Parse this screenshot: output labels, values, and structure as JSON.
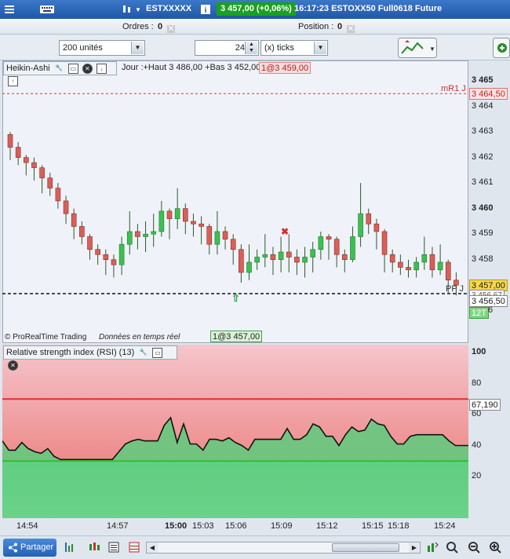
{
  "window": {
    "instrument": "ESTXXXXX",
    "price_change": "3 457,00 (+0,06%)",
    "time_name": "16:17:23 ESTOXX50 Full0618 Future",
    "icons": [
      "keyboard-icon",
      "chart-type-icon",
      "info-icon",
      "list-icon"
    ]
  },
  "order_bar": {
    "orders_label": "Ordres :",
    "orders_value": "0",
    "position_label": "Position :",
    "position_value": "0"
  },
  "toolbar": {
    "quantity": "200 unités",
    "ticks_value": "24",
    "ticks_unit": "(x) ticks"
  },
  "price_panel": {
    "indicator": "Heikin-Ashi",
    "info": "Jour :+Haut 3 486,00 +Bas 3 452,00",
    "order_tag": "1@3 459,00",
    "mr1_label": "mR1 J",
    "mr1_value": "3 464,50",
    "current_price": "3 457,00",
    "dashed_level": "3 456,67",
    "low_level": "3 456,50",
    "pp_label": "PP J",
    "tick_label": "12T",
    "tick_count": "6",
    "copyright": "© ProRealTime Trading",
    "realtime": "Données en temps réel",
    "fill_tag": "1@3 457,00",
    "y_labels": [
      {
        "v": 3465,
        "text": "3 465",
        "bold": true
      },
      {
        "v": 3464,
        "text": "3 464",
        "bold": false
      },
      {
        "v": 3463,
        "text": "3 463",
        "bold": false
      },
      {
        "v": 3462,
        "text": "3 462",
        "bold": false
      },
      {
        "v": 3461,
        "text": "3 461",
        "bold": false
      },
      {
        "v": 3460,
        "text": "3 460",
        "bold": true
      },
      {
        "v": 3459,
        "text": "3 459",
        "bold": false
      },
      {
        "v": 3458,
        "text": "3 458",
        "bold": false
      }
    ]
  },
  "rsi_panel": {
    "title": "Relative strength index (RSI) (13)",
    "value": "67,190",
    "y_labels": [
      "100",
      "80",
      "60",
      "40",
      "20"
    ],
    "upper": 70,
    "lower": 30
  },
  "x_axis": [
    {
      "text": "14:54",
      "bold": false
    },
    {
      "text": "14:57",
      "bold": false
    },
    {
      "text": "15:00",
      "bold": true
    },
    {
      "text": "15:03",
      "bold": false
    },
    {
      "text": "15:06",
      "bold": false
    },
    {
      "text": "15:09",
      "bold": false
    },
    {
      "text": "15:12",
      "bold": false
    },
    {
      "text": "15:15",
      "bold": false
    },
    {
      "text": "15:18",
      "bold": false
    },
    {
      "text": "15:24",
      "bold": false
    }
  ],
  "bottom_bar": {
    "share_label": "Partager"
  },
  "colors": {
    "bull": "#3cc050",
    "bear": "#d86058",
    "resistance": "#e03030",
    "support": "#30c030",
    "price_bg": "#f0f2fa"
  },
  "chart_data": {
    "type": "candlestick",
    "series": [
      {
        "name": "Heikin-Ashi",
        "ohlc": [
          [
            3462.9,
            3462.4,
            3463.0,
            3461.9
          ],
          [
            3462.4,
            3462.0,
            3462.6,
            3461.7
          ],
          [
            3462.0,
            3461.8,
            3462.1,
            3461.3
          ],
          [
            3461.8,
            3461.6,
            3462.0,
            3461.1
          ],
          [
            3461.6,
            3461.2,
            3461.7,
            3460.6
          ],
          [
            3461.2,
            3460.8,
            3461.4,
            3460.5
          ],
          [
            3460.8,
            3460.3,
            3461.0,
            3460.0
          ],
          [
            3460.3,
            3459.8,
            3460.5,
            3459.4
          ],
          [
            3459.8,
            3459.3,
            3460.0,
            3458.8
          ],
          [
            3459.3,
            3458.9,
            3459.5,
            3458.6
          ],
          [
            3458.9,
            3458.4,
            3459.0,
            3458.0
          ],
          [
            3458.4,
            3458.2,
            3458.6,
            3457.8
          ],
          [
            3458.2,
            3458.0,
            3458.4,
            3457.4
          ],
          [
            3458.0,
            3457.8,
            3458.2,
            3457.3
          ],
          [
            3457.8,
            3458.6,
            3458.9,
            3457.4
          ],
          [
            3458.6,
            3459.1,
            3459.9,
            3458.2
          ],
          [
            3459.1,
            3458.9,
            3459.4,
            3458.4
          ],
          [
            3458.9,
            3459.0,
            3459.5,
            3458.3
          ],
          [
            3459.0,
            3459.1,
            3459.8,
            3458.5
          ],
          [
            3459.1,
            3459.9,
            3460.3,
            3458.9
          ],
          [
            3459.9,
            3459.6,
            3460.0,
            3458.8
          ],
          [
            3459.6,
            3460.0,
            3460.8,
            3459.2
          ],
          [
            3460.0,
            3459.5,
            3460.2,
            3459.0
          ],
          [
            3459.5,
            3459.4,
            3459.8,
            3458.9
          ],
          [
            3459.4,
            3459.3,
            3459.7,
            3458.6
          ],
          [
            3459.3,
            3458.6,
            3459.4,
            3458.2
          ],
          [
            3458.6,
            3459.1,
            3459.9,
            3458.2
          ],
          [
            3459.1,
            3458.8,
            3459.3,
            3458.4
          ],
          [
            3458.8,
            3458.4,
            3459.0,
            3457.8
          ],
          [
            3458.4,
            3457.5,
            3458.6,
            3457.1
          ],
          [
            3457.5,
            3457.9,
            3458.6,
            3457.2
          ],
          [
            3457.9,
            3458.1,
            3458.4,
            3457.6
          ],
          [
            3458.1,
            3458.2,
            3459.0,
            3457.7
          ],
          [
            3458.2,
            3458.0,
            3458.5,
            3457.4
          ],
          [
            3458.0,
            3458.3,
            3458.9,
            3457.5
          ],
          [
            3458.3,
            3458.1,
            3459.0,
            3457.5
          ],
          [
            3458.1,
            3457.9,
            3458.4,
            3457.4
          ],
          [
            3457.9,
            3458.1,
            3458.5,
            3457.3
          ],
          [
            3458.1,
            3458.4,
            3458.7,
            3457.5
          ],
          [
            3458.4,
            3458.9,
            3459.1,
            3458.0
          ],
          [
            3458.9,
            3458.8,
            3459.0,
            3458.0
          ],
          [
            3458.8,
            3458.2,
            3458.9,
            3457.7
          ],
          [
            3458.2,
            3458.0,
            3458.4,
            3457.5
          ],
          [
            3458.0,
            3458.9,
            3459.3,
            3457.9
          ],
          [
            3458.9,
            3459.8,
            3461.0,
            3458.5
          ],
          [
            3459.8,
            3459.4,
            3460.0,
            3459.0
          ],
          [
            3459.4,
            3459.1,
            3459.6,
            3458.4
          ],
          [
            3459.1,
            3458.2,
            3459.2,
            3457.5
          ],
          [
            3458.2,
            3457.9,
            3458.4,
            3457.5
          ],
          [
            3457.9,
            3457.7,
            3458.2,
            3457.4
          ],
          [
            3457.7,
            3457.6,
            3458.0,
            3457.3
          ],
          [
            3457.6,
            3457.9,
            3458.1,
            3457.3
          ],
          [
            3457.9,
            3458.2,
            3458.9,
            3457.6
          ],
          [
            3458.2,
            3457.6,
            3458.5,
            3457.3
          ],
          [
            3457.6,
            3457.9,
            3458.6,
            3457.4
          ],
          [
            3457.9,
            3457.2,
            3458.0,
            3456.7
          ],
          [
            3457.2,
            3457.0,
            3457.5,
            3456.6
          ]
        ]
      },
      {
        "name": "RSI (13)",
        "values": [
          43,
          37,
          37,
          42,
          38,
          36,
          35,
          38,
          33,
          31,
          31,
          31,
          31,
          31,
          31,
          31,
          31,
          31,
          36,
          41,
          43,
          44,
          43,
          43,
          43,
          53,
          58,
          42,
          54,
          41,
          41,
          37,
          44,
          44,
          43,
          45,
          42,
          40,
          37,
          44,
          44,
          44,
          44,
          44,
          51,
          44,
          44,
          47,
          54,
          52,
          46,
          46,
          40,
          47,
          52,
          49,
          50,
          57,
          54,
          53,
          46,
          41,
          41,
          46,
          47,
          47,
          47,
          47,
          47,
          43,
          40,
          40,
          40
        ]
      }
    ],
    "xlabel": "",
    "ylabel": "",
    "ylim": [
      3455.5,
      3466.0
    ]
  }
}
